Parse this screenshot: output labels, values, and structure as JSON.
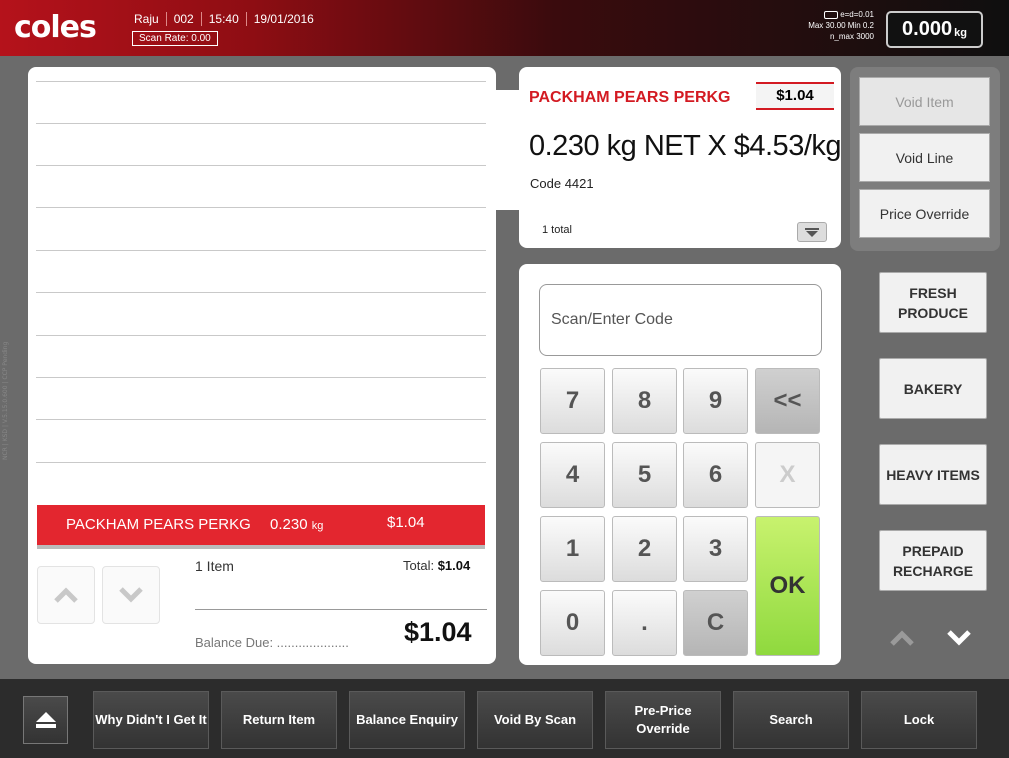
{
  "header": {
    "logo": "coles",
    "operator": "Raju",
    "lane": "002",
    "time": "15:40",
    "date": "19/01/2016",
    "scan_rate": "Scan Rate: 0.00",
    "scale_line1": "e=d=0.01",
    "scale_line2": "Max 30.00 Min 0.2",
    "scale_line3": "n_max 3000",
    "weight_value": "0.000",
    "weight_unit": "kg"
  },
  "side_text": "NCR | KSD | V.5.15.0.600 | CCP Pending",
  "receipt": {
    "selected_item": {
      "name": "PACKHAM PEARS PERKG",
      "weight": "0.230",
      "weight_unit": "kg",
      "price": "$1.04"
    },
    "item_count": "1 Item",
    "total_label": "Total:",
    "total_value": "$1.04",
    "balance_label": "Balance Due: ....................",
    "balance_value": "$1.04"
  },
  "item_card": {
    "name": "PACKHAM PEARS PERKG",
    "price": "$1.04",
    "detail": "0.230 kg NET X $4.53/kg",
    "code": "Code 4421",
    "total": "1 total"
  },
  "actions": {
    "void_item": "Void Item",
    "void_line": "Void Line",
    "price_override": "Price Override"
  },
  "keypad": {
    "placeholder": "Scan/Enter Code",
    "keys": [
      "7",
      "8",
      "9",
      "<<",
      "4",
      "5",
      "6",
      "X",
      "1",
      "2",
      "3",
      "OK",
      "0",
      ".",
      "C"
    ]
  },
  "categories": {
    "fresh_produce": "FRESH PRODUCE",
    "bakery": "BAKERY",
    "heavy_items": "HEAVY ITEMS",
    "prepaid_recharge": "PREPAID RECHARGE"
  },
  "bottom": {
    "why_didnt": "Why Didn't I Get It",
    "return_item": "Return Item",
    "balance_enquiry": "Balance Enquiry",
    "void_by_scan": "Void By Scan",
    "pre_price_override": "Pre-Price Override",
    "search": "Search",
    "lock": "Lock"
  },
  "colors": {
    "brand_red": "#e3262f",
    "ok_green": "#8fd93e"
  }
}
